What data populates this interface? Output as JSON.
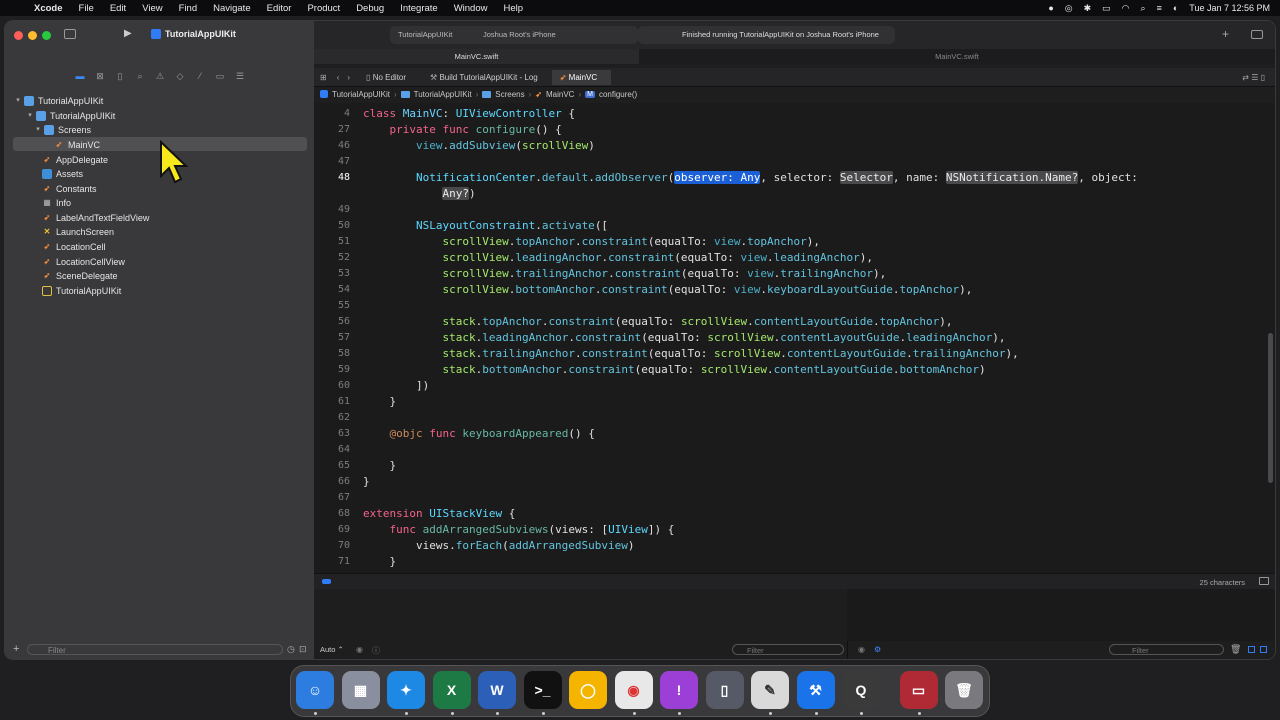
{
  "menubar": {
    "app": "Xcode",
    "items": [
      "File",
      "Edit",
      "View",
      "Find",
      "Navigate",
      "Editor",
      "Product",
      "Debug",
      "Integrate",
      "Window",
      "Help"
    ],
    "clock": "Tue Jan 7  12:56 PM"
  },
  "toolbar": {
    "scheme": "TutorialAppUIKit",
    "destination_scheme": "TutorialAppUIKit",
    "destination_device": "Joshua Root's iPhone",
    "status": "Finished running TutorialAppUIKit on Joshua Root's iPhone"
  },
  "file_tabs": {
    "left": "MainVC.swift",
    "right": "MainVC.swift"
  },
  "editor_tabs": [
    "No Editor",
    "Build TutorialAppUIKit - Log",
    "MainVC"
  ],
  "jumpbar": [
    "TutorialAppUIKit",
    "TutorialAppUIKit",
    "Screens",
    "MainVC",
    "configure()"
  ],
  "navigator": {
    "filter_placeholder": "Filter",
    "tree": [
      {
        "label": "TutorialAppUIKit",
        "depth": 0,
        "kind": "project"
      },
      {
        "label": "TutorialAppUIKit",
        "depth": 1,
        "kind": "folder"
      },
      {
        "label": "Screens",
        "depth": 2,
        "kind": "folder"
      },
      {
        "label": "MainVC",
        "depth": 3,
        "kind": "swift",
        "selected": true
      },
      {
        "label": "AppDelegate",
        "depth": 2,
        "kind": "swift"
      },
      {
        "label": "Assets",
        "depth": 2,
        "kind": "assets"
      },
      {
        "label": "Constants",
        "depth": 2,
        "kind": "swift"
      },
      {
        "label": "Info",
        "depth": 2,
        "kind": "plist"
      },
      {
        "label": "LabelAndTextFieldView",
        "depth": 2,
        "kind": "swift"
      },
      {
        "label": "LaunchScreen",
        "depth": 2,
        "kind": "storyboard"
      },
      {
        "label": "LocationCell",
        "depth": 2,
        "kind": "swift"
      },
      {
        "label": "LocationCellView",
        "depth": 2,
        "kind": "swift"
      },
      {
        "label": "SceneDelegate",
        "depth": 2,
        "kind": "swift"
      },
      {
        "label": "TutorialAppUIKit",
        "depth": 2,
        "kind": "entitlements"
      }
    ]
  },
  "code": {
    "current_line": "48",
    "lines": [
      {
        "n": "4",
        "t": "class MainVC: UIViewController {"
      },
      {
        "n": "27",
        "t": "    private func configure() {"
      },
      {
        "n": "46",
        "t": "        view.addSubview(scrollView)"
      },
      {
        "n": "47",
        "t": ""
      },
      {
        "n": "48",
        "t": "        NotificationCenter.default.addObserver(observer: Any, selector: Selector, name: NSNotification.Name?, object:"
      },
      {
        "n": "",
        "t": "            Any?)"
      },
      {
        "n": "49",
        "t": ""
      },
      {
        "n": "50",
        "t": "        NSLayoutConstraint.activate(["
      },
      {
        "n": "51",
        "t": "            scrollView.topAnchor.constraint(equalTo: view.topAnchor),"
      },
      {
        "n": "52",
        "t": "            scrollView.leadingAnchor.constraint(equalTo: view.leadingAnchor),"
      },
      {
        "n": "53",
        "t": "            scrollView.trailingAnchor.constraint(equalTo: view.trailingAnchor),"
      },
      {
        "n": "54",
        "t": "            scrollView.bottomAnchor.constraint(equalTo: view.keyboardLayoutGuide.topAnchor),"
      },
      {
        "n": "55",
        "t": ""
      },
      {
        "n": "56",
        "t": "            stack.topAnchor.constraint(equalTo: scrollView.contentLayoutGuide.topAnchor),"
      },
      {
        "n": "57",
        "t": "            stack.leadingAnchor.constraint(equalTo: scrollView.contentLayoutGuide.leadingAnchor),"
      },
      {
        "n": "58",
        "t": "            stack.trailingAnchor.constraint(equalTo: scrollView.contentLayoutGuide.trailingAnchor),"
      },
      {
        "n": "59",
        "t": "            stack.bottomAnchor.constraint(equalTo: scrollView.contentLayoutGuide.bottomAnchor)"
      },
      {
        "n": "60",
        "t": "        ])"
      },
      {
        "n": "61",
        "t": "    }"
      },
      {
        "n": "62",
        "t": ""
      },
      {
        "n": "63",
        "t": "    @objc func keyboardAppeared() {"
      },
      {
        "n": "64",
        "t": ""
      },
      {
        "n": "65",
        "t": "    }"
      },
      {
        "n": "66",
        "t": "}"
      },
      {
        "n": "67",
        "t": ""
      },
      {
        "n": "68",
        "t": "extension UIStackView {"
      },
      {
        "n": "69",
        "t": "    func addArrangedSubviews(views: [UIView]) {"
      },
      {
        "n": "70",
        "t": "        views.forEach(addArrangedSubview)"
      },
      {
        "n": "71",
        "t": "    }"
      }
    ]
  },
  "status": {
    "characters": "25 characters"
  },
  "debug": {
    "mode": "Auto",
    "filter_left": "Filter",
    "filter_right": "Filter"
  },
  "dock": {
    "apps": [
      {
        "name": "finder",
        "bg": "#2d7de0",
        "glyph": "☺"
      },
      {
        "name": "launchpad",
        "bg": "#8a8fa0",
        "glyph": "▦"
      },
      {
        "name": "safari",
        "bg": "#1e88e5",
        "glyph": "✦"
      },
      {
        "name": "excel",
        "bg": "#1e7a44",
        "glyph": "X"
      },
      {
        "name": "word",
        "bg": "#2b5fb8",
        "glyph": "W"
      },
      {
        "name": "terminal",
        "bg": "#111111",
        "glyph": ">_"
      },
      {
        "name": "keynote-like",
        "bg": "#f5b400",
        "glyph": "◯"
      },
      {
        "name": "chrome",
        "bg": "#e8e8e8",
        "glyph": "◉"
      },
      {
        "name": "feedback",
        "bg": "#9b3fd6",
        "glyph": "!"
      },
      {
        "name": "iphone-mirroring",
        "bg": "#555a66",
        "glyph": "▯"
      },
      {
        "name": "textedit",
        "bg": "#d9d9d9",
        "glyph": "✎"
      },
      {
        "name": "xcode",
        "bg": "#1a73e8",
        "glyph": "⚒"
      },
      {
        "name": "quicktime",
        "bg": "#3a3a3a",
        "glyph": "Q"
      },
      {
        "name": "folder-app",
        "bg": "#b02a35",
        "glyph": "▭"
      },
      {
        "name": "trash",
        "bg": "#7a7a7e",
        "glyph": "🗑"
      }
    ]
  }
}
